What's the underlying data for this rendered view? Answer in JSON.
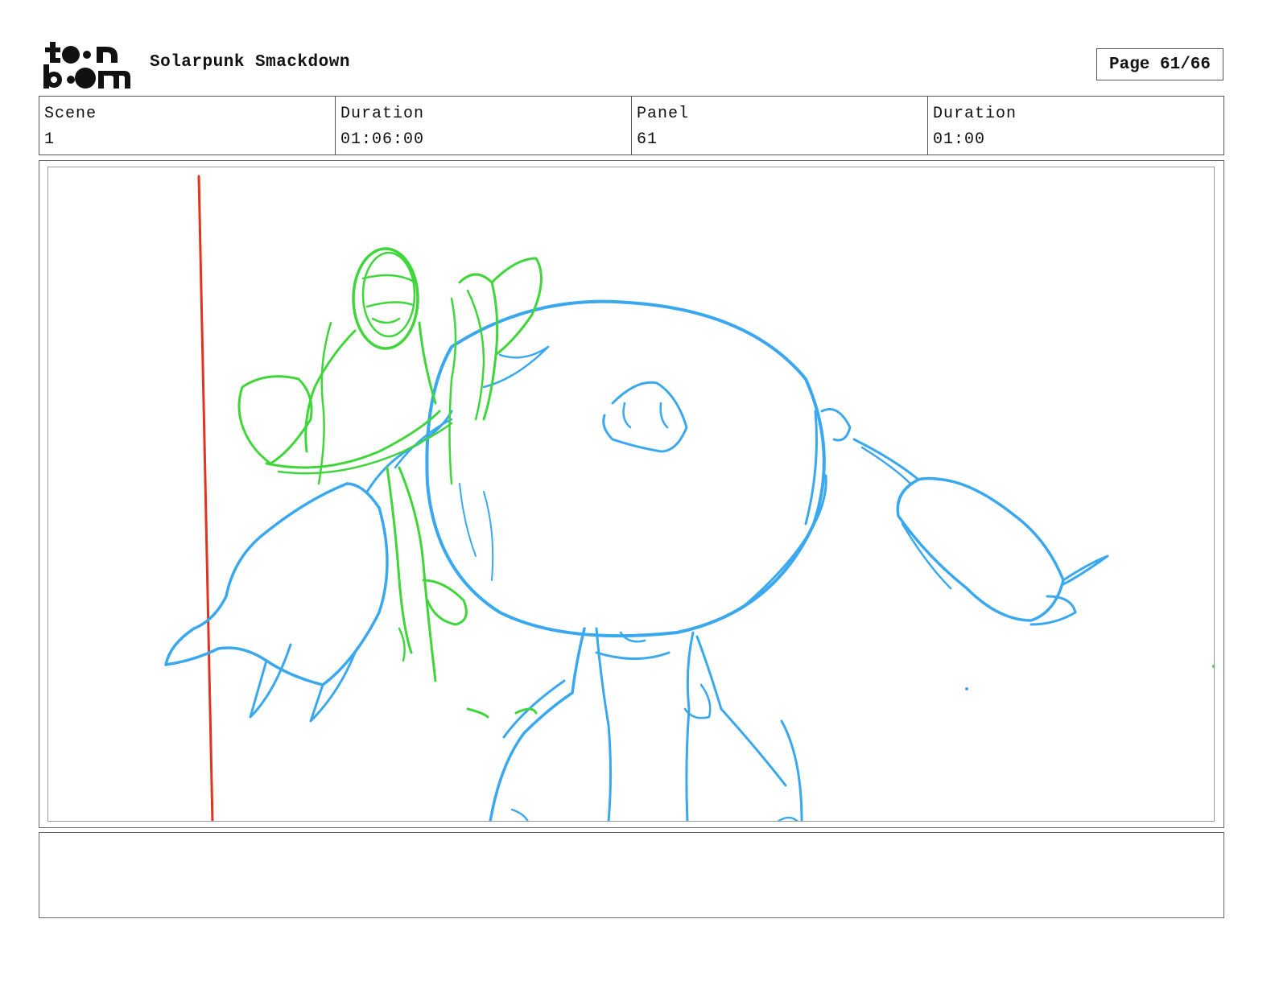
{
  "header": {
    "logo_text": "toon boom",
    "project_title": "Solarpunk Smackdown",
    "page_label": "Page 61/66"
  },
  "info": {
    "scene_label": "Scene",
    "scene_value": "1",
    "scene_duration_label": "Duration",
    "scene_duration_value": "01:06:00",
    "panel_label": "Panel",
    "panel_value": "61",
    "panel_duration_label": "Duration",
    "panel_duration_value": "01:00"
  },
  "colors": {
    "blue_sketch": "#3aa8ee",
    "green_sketch": "#3fd63a",
    "red_line": "#e0341e"
  },
  "dialogue": {
    "text": ""
  }
}
